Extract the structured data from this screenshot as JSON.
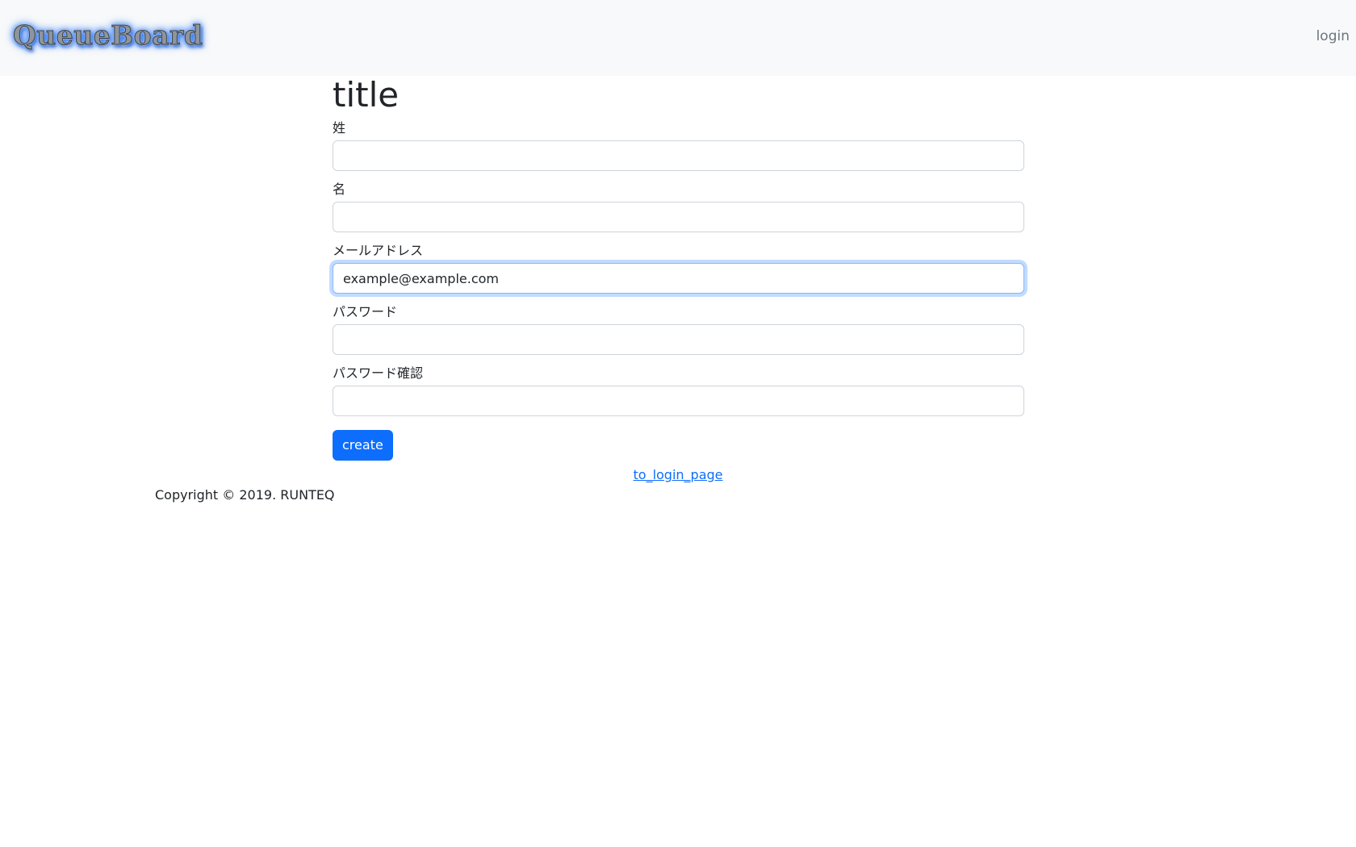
{
  "navbar": {
    "brand": "QueueBoard",
    "login_label": "login"
  },
  "form": {
    "title": "title",
    "fields": [
      {
        "label": "姓",
        "value": "",
        "type": "text"
      },
      {
        "label": "名",
        "value": "",
        "type": "text"
      },
      {
        "label": "メールアドレス",
        "value": "example@example.com",
        "type": "email",
        "focused": true
      },
      {
        "label": "パスワード",
        "value": "",
        "type": "password"
      },
      {
        "label": "パスワード確認",
        "value": "",
        "type": "password"
      }
    ],
    "submit_label": "create"
  },
  "links": {
    "to_login": "to_login_page"
  },
  "footer": {
    "copyright": "Copyright © 2019. RUNTEQ"
  },
  "colors": {
    "navbar_bg": "#f8f9fa",
    "primary": "#0d6efd",
    "focus_border": "#86b7fe",
    "text": "#212529",
    "muted": "#6c757d"
  }
}
